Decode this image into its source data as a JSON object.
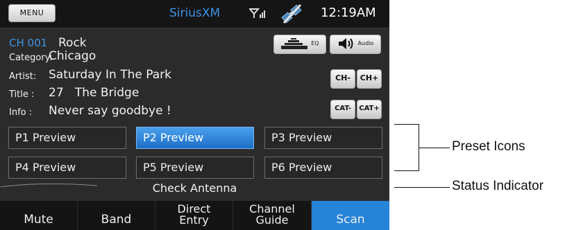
{
  "topbar": {
    "menu_label": "MENU",
    "brand": "SiriusXM",
    "clock": "12:19AM",
    "signal_icon": "signal-strength-icon",
    "satellite_icon": "satellite-crossed-icon"
  },
  "channel": {
    "number": "CH 001",
    "name": "Rock",
    "category_label": "Category:",
    "category": "Chicago",
    "artist_label": "Artist:",
    "artist": "Saturday In The Park",
    "title_label": "Title :",
    "title": "27   The Bridge",
    "info_label": "Info :",
    "info": "Never say goodbye !"
  },
  "side_buttons": {
    "eq_label": "EQ",
    "audio_label": "Audio",
    "ch_minus": "CH-",
    "ch_plus": "CH+",
    "cat_minus": "CAT-",
    "cat_plus": "CAT+"
  },
  "presets": [
    "P1 Preview",
    "P2 Preview",
    "P3 Preview",
    "P4 Preview",
    "P5 Preview",
    "P6 Preview"
  ],
  "selected_preset": "P2 Preview",
  "status": "Check Antenna",
  "bottom_bar": {
    "mute": "Mute",
    "band": "Band",
    "direct_1": "Direct",
    "direct_2": "Entry",
    "guide_1": "Channel",
    "guide_2": "Guide",
    "scan": "Scan"
  },
  "annotations": {
    "preset_icons": "Preset Icons",
    "status_indicator": "Status Indicator"
  },
  "colors": {
    "accent_blue": "#3d94e6",
    "selected_blue": "#2583d8",
    "background": "#2b2b2b"
  }
}
